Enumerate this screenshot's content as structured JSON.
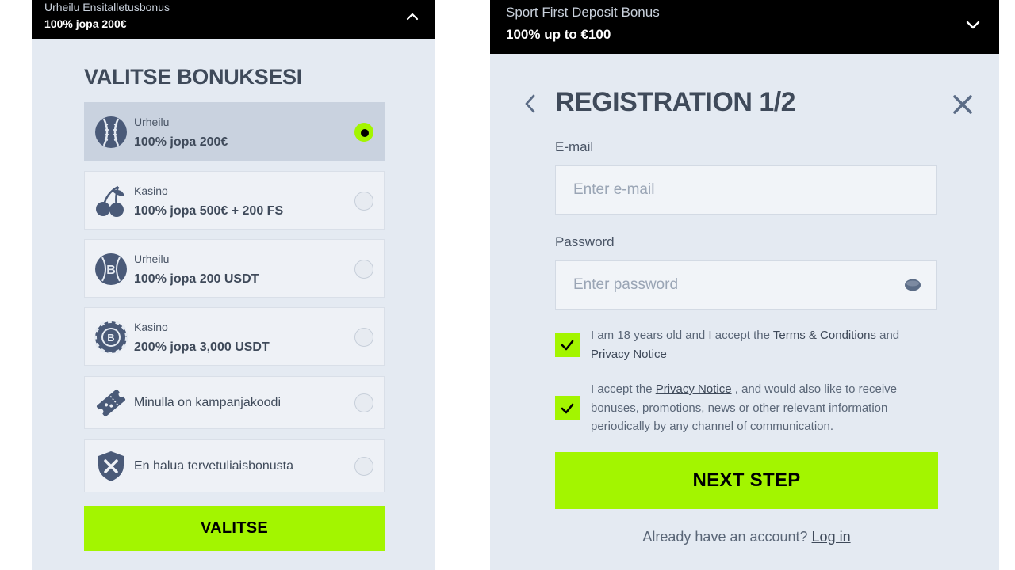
{
  "left": {
    "header": {
      "title": "Urheilu Ensitalletusbonus",
      "subtitle": "100% jopa 200€",
      "toggle_icon": "chevron-up-icon"
    },
    "heading": "VALITSE BONUKSESI",
    "options": [
      {
        "category": "Urheilu",
        "value": "100% jopa 200€",
        "icon": "baseball-icon",
        "selected": true
      },
      {
        "category": "Kasino",
        "value": "100% jopa 500€ + 200 FS",
        "icon": "cherries-icon",
        "selected": false
      },
      {
        "category": "Urheilu",
        "value": "100% jopa 200 USDT",
        "icon": "bitcoin-ball-icon",
        "selected": false
      },
      {
        "category": "Kasino",
        "value": "200% jopa 3,000 USDT",
        "icon": "bitcoin-chip-icon",
        "selected": false
      },
      {
        "label": "Minulla on kampanjakoodi",
        "icon": "ticket-icon",
        "selected": false
      },
      {
        "label": "En halua tervetuliaisbonusta",
        "icon": "shield-x-icon",
        "selected": false
      }
    ],
    "submit_label": "VALITSE"
  },
  "right": {
    "header": {
      "title": "Sport First Deposit Bonus",
      "subtitle": "100% up to €100",
      "toggle_icon": "chevron-down-icon"
    },
    "title": "REGISTRATION 1/2",
    "email": {
      "label": "E-mail",
      "placeholder": "Enter e-mail"
    },
    "password": {
      "label": "Password",
      "placeholder": "Enter password"
    },
    "consent1": {
      "before": "I am 18 years old and I accept the ",
      "link1": "Terms & Conditions",
      "middle": " and ",
      "link2": "Privacy Notice",
      "checked": true
    },
    "consent2": {
      "before": "I accept the ",
      "link": "Privacy Notice",
      "after": " , and would also like to receive bonuses, promotions, news or other relevant information periodically by any channel of communication.",
      "checked": true
    },
    "next_label": "NEXT STEP",
    "login_prompt": "Already have an account? ",
    "login_link": "Log in"
  },
  "colors": {
    "accent": "#a3f500",
    "panel_bg": "#e4eaf2",
    "text_dark": "#3f4a5a",
    "header_bg": "#000000"
  }
}
